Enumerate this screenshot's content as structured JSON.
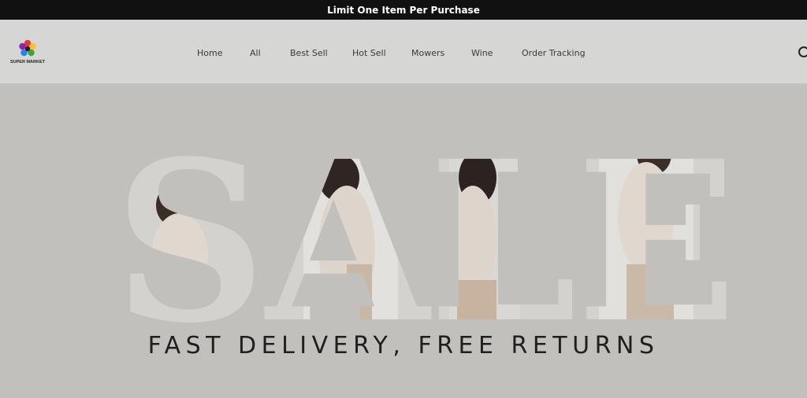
{
  "announcement": {
    "text": "Limit One Item Per Purchase"
  },
  "logo": {
    "text": "SUPER MARKET",
    "icon": "flower-logo-icon"
  },
  "nav": {
    "items": [
      {
        "label": "Home"
      },
      {
        "label": "All"
      },
      {
        "label": "Best Sell"
      },
      {
        "label": "Hot Sell"
      },
      {
        "label": "Mowers"
      },
      {
        "label": "Wine"
      },
      {
        "label": "Order Tracking"
      }
    ]
  },
  "header": {
    "search_icon": "search-icon"
  },
  "hero": {
    "headline": "SALE",
    "tagline": "FAST DELIVERY, FREE RETURNS"
  },
  "colors": {
    "announcement_bg": "#111111",
    "header_bg": "#d6d6d5",
    "hero_bg": "#c2c0bd",
    "letter_fill": "#d3d1ce",
    "photo_tone": "#e4e2df",
    "text_dark": "#1f1f1f"
  }
}
